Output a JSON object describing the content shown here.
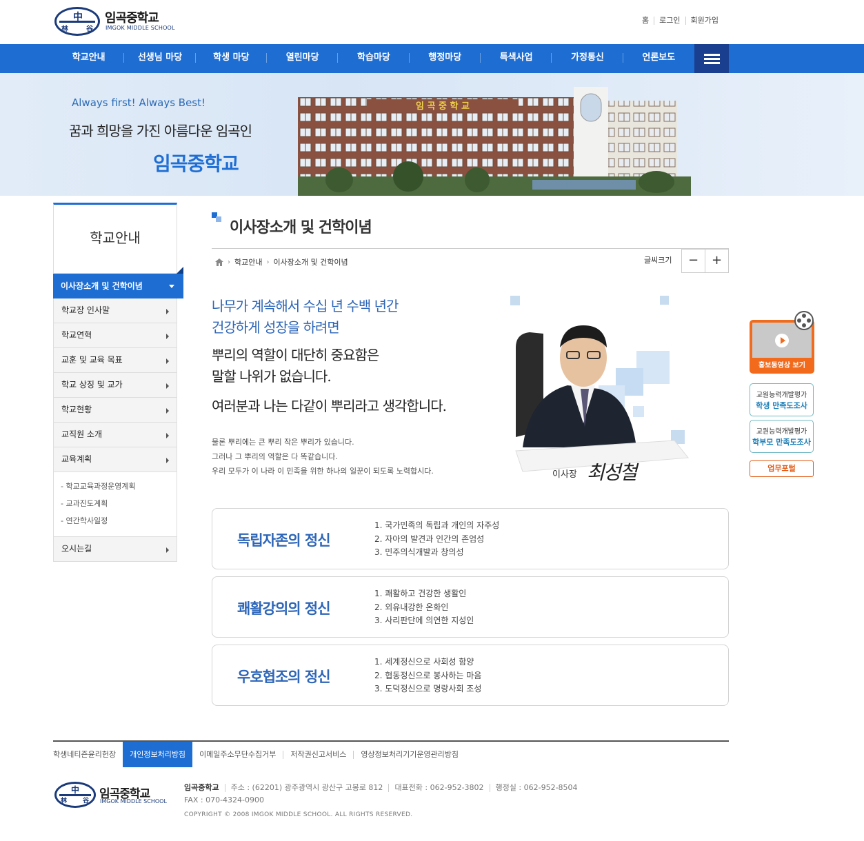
{
  "header": {
    "logo_title": "임곡중학교",
    "logo_sub": "IMGOK MIDDLE SCHOOL",
    "emblem_chars": [
      "林",
      "中",
      "谷"
    ],
    "util_links": [
      "홈",
      "로그인",
      "회원가입"
    ]
  },
  "gnb": {
    "items": [
      "학교안내",
      "선생님 마당",
      "학생 마당",
      "열린마당",
      "학습마당",
      "행정마당",
      "특색사업",
      "가정통신",
      "언론보도"
    ],
    "accent": "#1d6dd3"
  },
  "visual": {
    "slogan_en": "Always first! Always Best!",
    "slogan_kr": "꿈과 희망을 가진 아름다운 임곡인",
    "school_name": "임곡중학교",
    "building_sign": "임 곡 중 학 교"
  },
  "lnb": {
    "title": "학교안내",
    "active": "이사장소개 및 건학이념",
    "items": [
      "학교장 인사말",
      "학교연혁",
      "교훈 및 교육 목표",
      "학교 상징 및 교가",
      "학교현황",
      "교직원 소개",
      "교육계획"
    ],
    "sub_items": [
      "- 학교교육과정운영계획",
      "- 교과진도계획",
      "- 연간학사일정"
    ],
    "last_item": "오시는길"
  },
  "content": {
    "page_title": "이사장소개 및 건학이념",
    "breadcrumb": [
      "학교안내",
      "이사장소개 및 건학이념"
    ],
    "font_size_label": "글씨크기",
    "font_minus": "−",
    "font_plus": "+",
    "msg_blue": [
      "나무가 계속해서 수십 년 수백 년간",
      "건강하게 성장을 하려면"
    ],
    "msg_black": [
      "뿌리의 역할이 대단히 중요함은",
      "말할 나위가 없습니다."
    ],
    "msg_line3": "여러분과 나는 다같이 뿌리라고 생각합니다.",
    "msg_small": [
      "물론 뿌리에는 큰 뿌리 작은 뿌리가 있습니다.",
      "그러나 그 뿌리의 역할은 다 똑같습니다.",
      "우리 모두가 이 나라 이 민족을 위한 하나의 일꾼이 되도록 노력합시다."
    ],
    "sign_label": "이사장",
    "sign_name": "최성철",
    "spirits": [
      {
        "title": "독립자존의 정신",
        "items": [
          "1. 국가민족의 독립과 개인의 자주성",
          "2. 자아의 발견과 인간의 존엄성",
          "3. 민주의식개발과 창의성"
        ]
      },
      {
        "title": "쾌활강의의 정신",
        "items": [
          "1. 쾌활하고 건강한 생활인",
          "2. 외유내강한 온화인",
          "3. 사리판단에 의연한 지성인"
        ]
      },
      {
        "title": "우호협조의 정신",
        "items": [
          "1. 세계정신으로 사회성 함양",
          "2. 협동정신으로 봉사하는 마음",
          "3. 도덕정신으로 명랑사회 조성"
        ]
      }
    ]
  },
  "quick": {
    "video_label": "홍보동영상 보기",
    "box1": {
      "l1": "교원능력개발평가",
      "l2": "학생 만족도조사"
    },
    "box2": {
      "l1": "교원능력개발평가",
      "l2": "학부모 만족도조사"
    },
    "portal": "업무포털"
  },
  "footer": {
    "links": [
      "학생네티즌윤리헌장",
      "개인정보처리방침",
      "이메일주소무단수집거부",
      "저작권신고서비스",
      "영상정보처리기기운영관리방침"
    ],
    "active_link": "개인정보처리방침",
    "school": "임곡중학교",
    "address": "주소 : (62201) 광주광역시 광산구 고봉로 812",
    "tel": "대표전화 : 062-952-3802",
    "admin": "행정실 : 062-952-8504",
    "fax": "FAX : 070-4324-0900",
    "copyright": "COPYRIGHT © 2008 IMGOK MIDDLE SCHOOL. ALL RIGHTS RESERVED."
  }
}
